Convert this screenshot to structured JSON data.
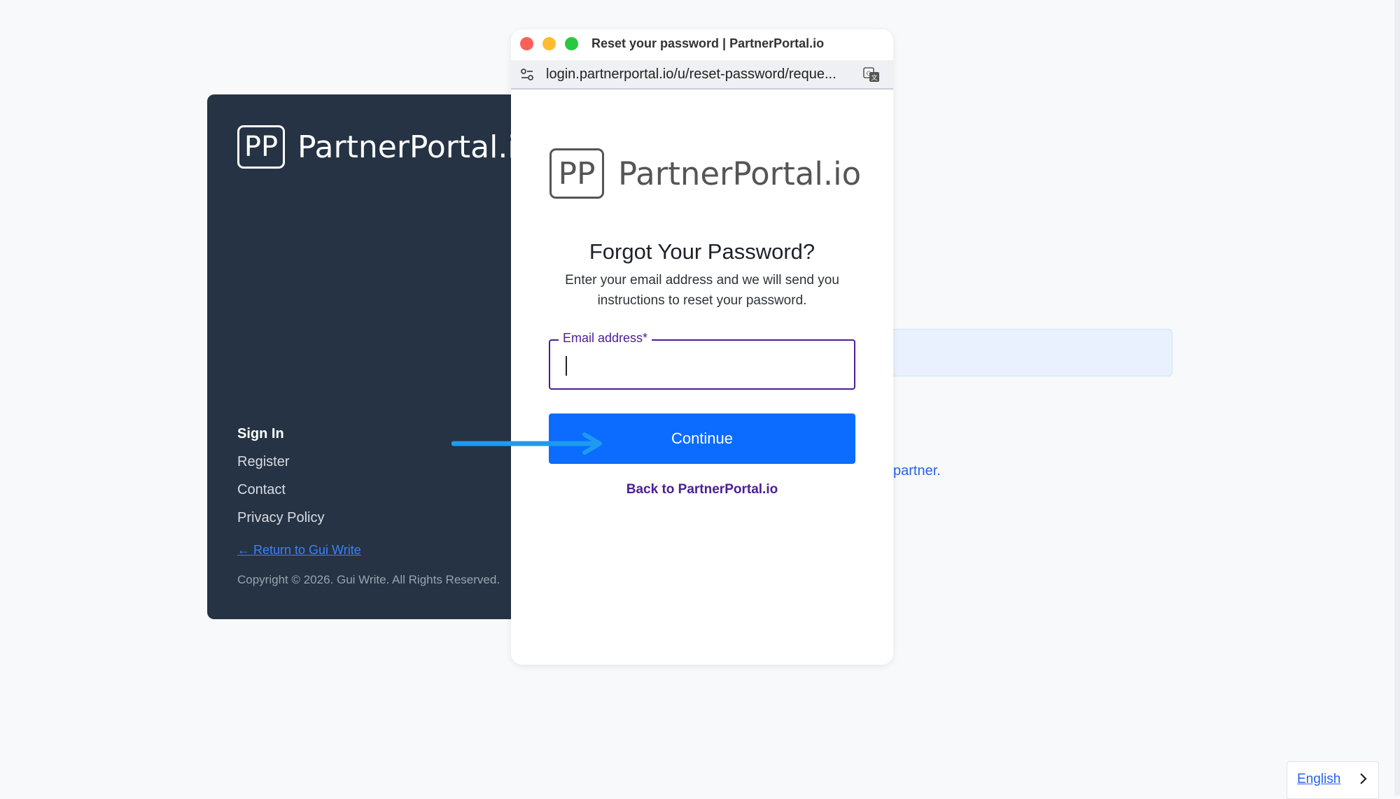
{
  "background": {
    "logo_mark": "PP",
    "logo_text": "PartnerPortal.io",
    "nav": [
      "Sign In",
      "Register",
      "Contact",
      "Privacy Policy"
    ],
    "return_link": "← Return to Gui Write",
    "copyright": "Copyright © 2026. Gui Write. All Rights Reserved.",
    "link_fragment": "partner."
  },
  "popup": {
    "window_title": "Reset your password | PartnerPortal.io",
    "url": "login.partnerportal.io/u/reset-password/reque...",
    "logo_mark": "PP",
    "logo_text": "PartnerPortal.io",
    "heading": "Forgot Your Password?",
    "description": "Enter your email address and we will send you instructions to reset your password.",
    "email_label": "Email address*",
    "email_value": "",
    "continue_label": "Continue",
    "back_link": "Back to PartnerPortal.io"
  },
  "language": {
    "label": "English"
  },
  "icons": {
    "site_settings": "tune-icon",
    "translate": "translate-icon",
    "arrow": "arrow-right-icon",
    "chevron": "chevron-right-icon"
  },
  "colors": {
    "sidebar": "#263344",
    "primary_button": "#0b6cff",
    "accent_purple": "#4c1d95",
    "link_blue": "#2563eb"
  }
}
